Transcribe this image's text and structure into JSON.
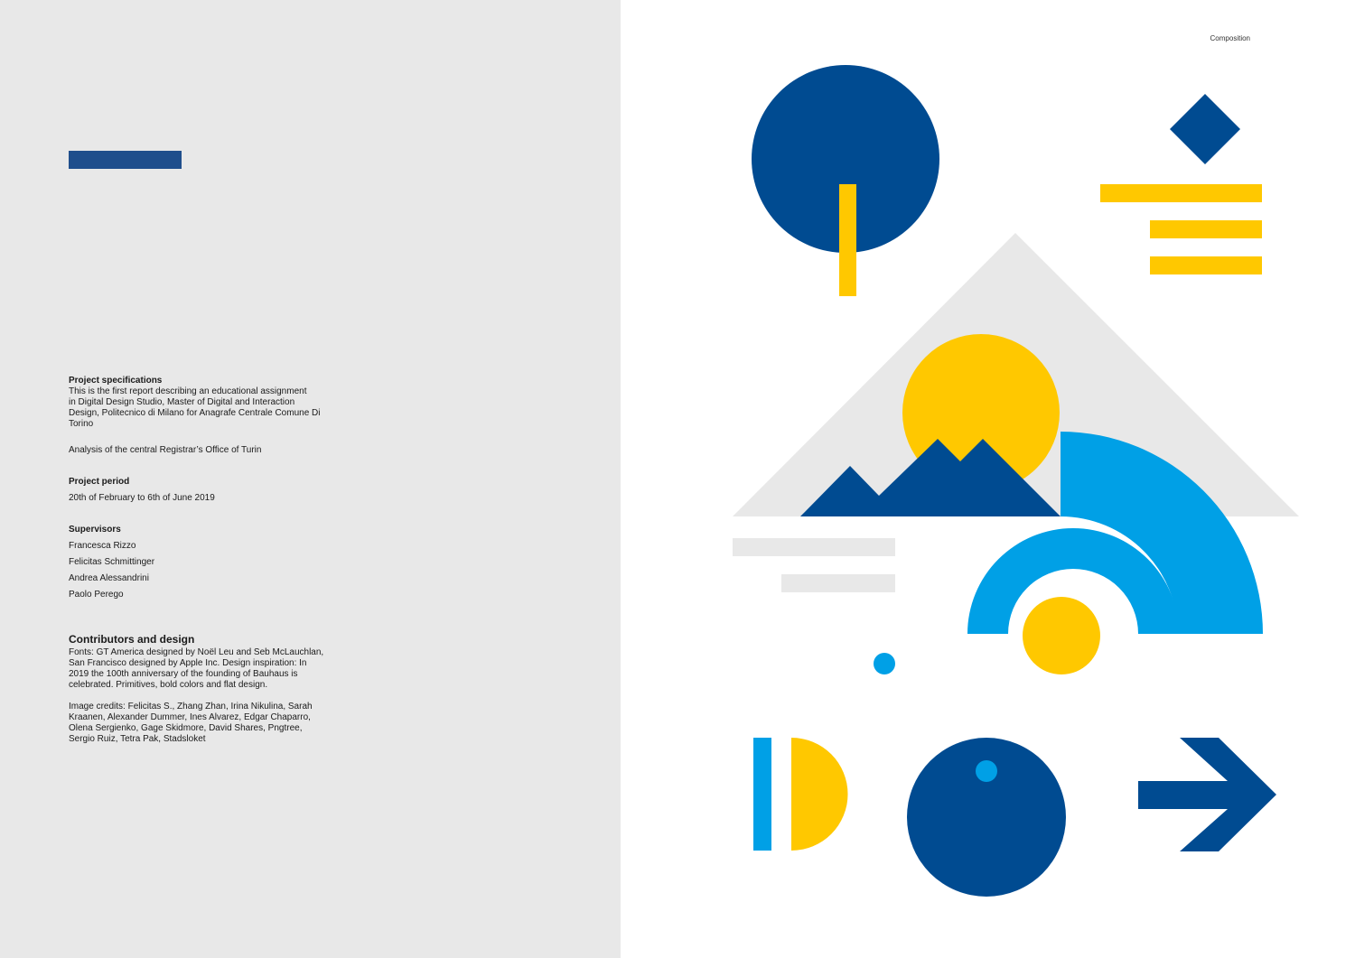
{
  "colors": {
    "navy": "#004b91",
    "yellow": "#ffc800",
    "sky": "#00a0e6",
    "light_gray": "#e8e8e8",
    "accent_bar": "#1f4e8c"
  },
  "left": {
    "spec_heading": "Project specifications",
    "spec_text": "This is the first report describing an educational assignment\nin Digital Design Studio, Master of Digital and Interaction\nDesign, Politecnico di Milano for Anagrafe Centrale Comune Di\nTorino",
    "analysis_text": "Analysis of the central Registrar’s Office of Turin",
    "period_heading": "Project period",
    "period_text": "20th of February to 6th of June 2019",
    "supervisors_heading": "Supervisors",
    "supervisors": [
      "Francesca Rizzo",
      "Felicitas Schmittinger",
      "Andrea Alessandrini",
      "Paolo Perego"
    ],
    "contributors_heading": "Contributors and design",
    "fonts_text": "Fonts: GT America designed by Noël Leu and Seb McLauchlan,\nSan Francisco designed by Apple Inc. Design inspiration: In\n2019 the 100th anniversary of the founding of Bauhaus is\ncelebrated. Primitives, bold colors and flat design.",
    "credits_text": "Image credits: Felicitas S., Zhang Zhan, Irina Nikulina, Sarah\nKraanen, Alexander Dummer, Ines Alvarez, Edgar Chaparro,\nOlena Sergienko, Gage Skidmore, David Shares, Pngtree,\nSergio Ruiz, Tetra Pak, Stadsloket"
  },
  "right": {
    "page_label": "Composition",
    "shapes": [
      "tree-circle",
      "tree-trunk",
      "diamond",
      "yellow-stripes",
      "gray-triangle",
      "sun",
      "mountains",
      "quarter-arc",
      "half-ring",
      "yellow-dot",
      "gray-stripes",
      "small-blue-dot",
      "letter-d",
      "blue-ball",
      "arrow"
    ]
  }
}
